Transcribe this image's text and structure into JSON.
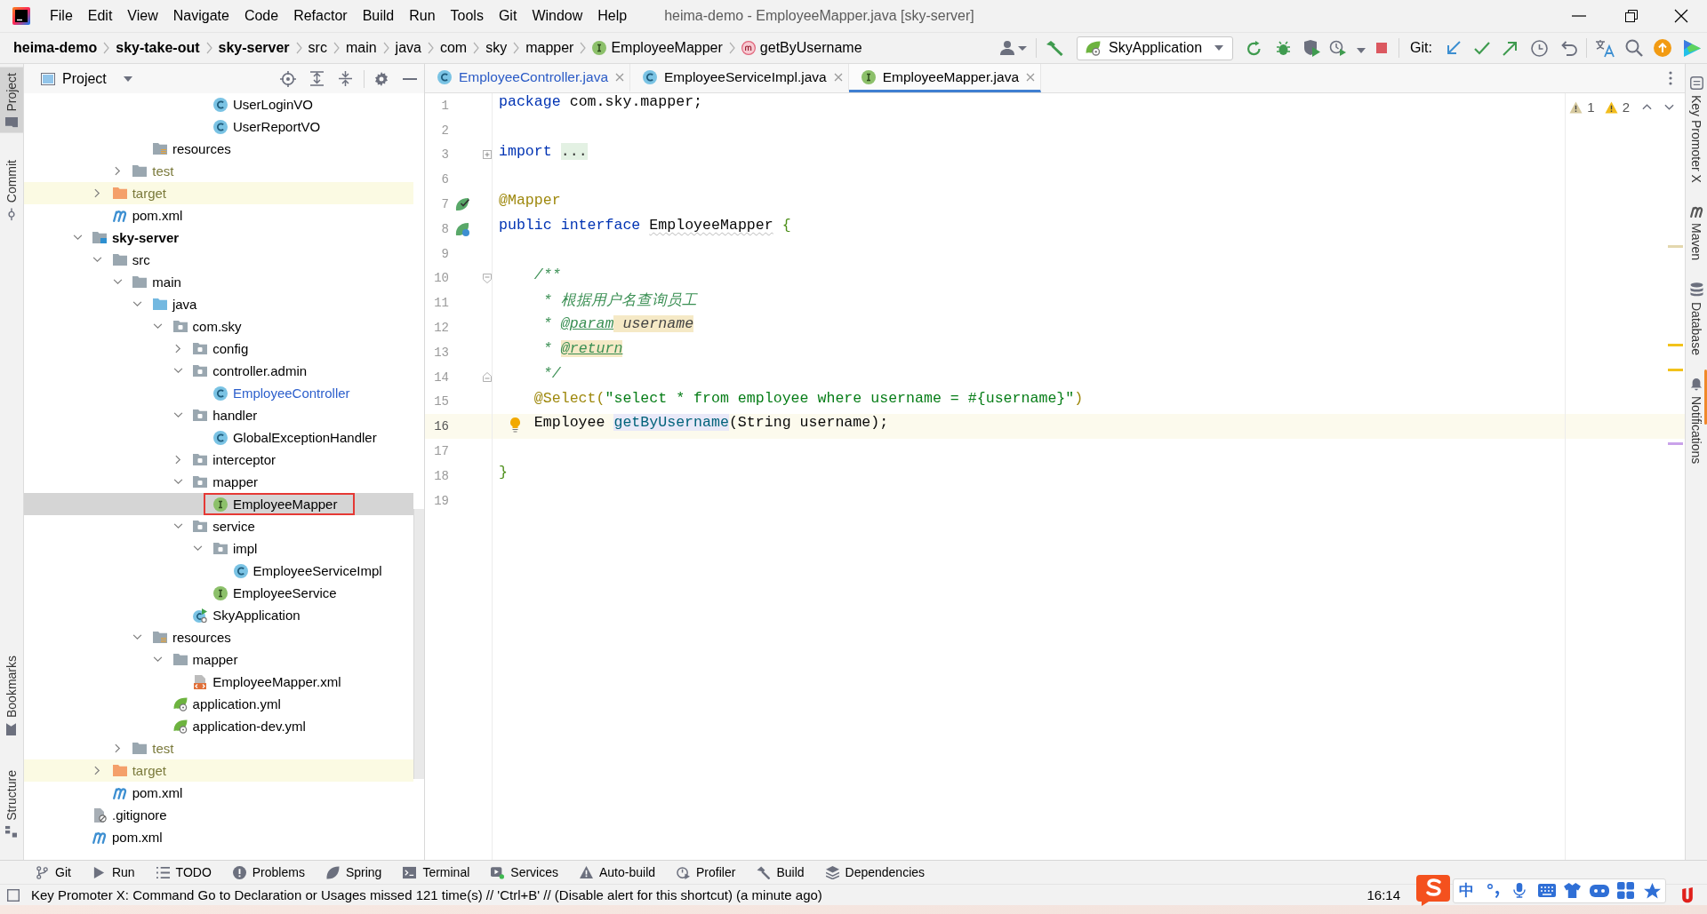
{
  "menubar": {
    "items": [
      "File",
      "Edit",
      "View",
      "Navigate",
      "Code",
      "Refactor",
      "Build",
      "Run",
      "Tools",
      "Git",
      "Window",
      "Help"
    ],
    "title": "heima-demo - EmployeeMapper.java [sky-server]"
  },
  "navbar": {
    "breadcrumbs": [
      {
        "label": "heima-demo",
        "kind": "root"
      },
      {
        "label": "sky-take-out",
        "kind": "root"
      },
      {
        "label": "sky-server",
        "kind": "root"
      },
      {
        "label": "src",
        "kind": "dir"
      },
      {
        "label": "main",
        "kind": "dir"
      },
      {
        "label": "java",
        "kind": "dir"
      },
      {
        "label": "com",
        "kind": "dir"
      },
      {
        "label": "sky",
        "kind": "dir"
      },
      {
        "label": "mapper",
        "kind": "dir"
      },
      {
        "label": "EmployeeMapper",
        "kind": "interface"
      },
      {
        "label": "getByUsername",
        "kind": "method"
      }
    ],
    "run_config": "SkyApplication",
    "git_label": "Git:"
  },
  "left_strip": {
    "top": [
      {
        "label": "Project",
        "kind": "project",
        "selected": true
      },
      {
        "label": "Commit",
        "kind": "commit",
        "selected": false
      }
    ],
    "bottom": [
      {
        "label": "Bookmarks",
        "kind": "bookmarks",
        "selected": false
      },
      {
        "label": "Structure",
        "kind": "structure",
        "selected": false
      }
    ]
  },
  "project_panel": {
    "title": "Project",
    "tree": [
      {
        "children": [
          {
            "children": [
              {
                "children": [
                  {
                    "children": [
                      {
                        "children": [
                          {
                            "children": [
                              {
                                "children": [
                                  {
                                    "label": "UserLoginVO",
                                    "kind": "class",
                                    "selected": false,
                                    "modified": false,
                                    "boxed": false
                                  },
                                  {
                                    "label": "UserReportVO",
                                    "kind": "class",
                                    "selected": false,
                                    "modified": false,
                                    "boxed": false
                                  }
                                ]
                              }
                            ]
                          }
                        ]
                      },
                      {
                        "label": "resources",
                        "kind": "resources",
                        "selected": false,
                        "modified": false,
                        "boxed": false
                      }
                    ]
                  },
                  {
                    "label": "test",
                    "kind": "test",
                    "expanded": false,
                    "selected": false,
                    "modified": false,
                    "boxed": false
                  }
                ]
              },
              {
                "label": "target",
                "kind": "excluded",
                "expanded": false,
                "selected": false,
                "modified": false,
                "boxed": false
              },
              {
                "label": "pom.xml",
                "kind": "maven",
                "selected": false,
                "modified": false,
                "boxed": false
              }
            ]
          },
          {
            "label": "sky-server",
            "kind": "module",
            "expanded": true,
            "selected": false,
            "modified": false,
            "boxed": false,
            "children": [
              {
                "label": "src",
                "kind": "folder",
                "expanded": true,
                "selected": false,
                "modified": false,
                "boxed": false,
                "children": [
                  {
                    "label": "main",
                    "kind": "folder",
                    "expanded": true,
                    "selected": false,
                    "modified": false,
                    "boxed": false,
                    "children": [
                      {
                        "label": "java",
                        "kind": "source",
                        "expanded": true,
                        "selected": false,
                        "modified": false,
                        "boxed": false,
                        "children": [
                          {
                            "label": "com.sky",
                            "kind": "package",
                            "expanded": true,
                            "selected": false,
                            "modified": false,
                            "boxed": false,
                            "children": [
                              {
                                "label": "config",
                                "kind": "package",
                                "expanded": false,
                                "selected": false,
                                "modified": false,
                                "boxed": false
                              },
                              {
                                "label": "controller.admin",
                                "kind": "package",
                                "expanded": true,
                                "selected": false,
                                "modified": false,
                                "boxed": false,
                                "children": [
                                  {
                                    "label": "EmployeeController",
                                    "kind": "class",
                                    "selected": false,
                                    "modified": true,
                                    "boxed": false
                                  }
                                ]
                              },
                              {
                                "label": "handler",
                                "kind": "package",
                                "expanded": true,
                                "selected": false,
                                "modified": false,
                                "boxed": false,
                                "children": [
                                  {
                                    "label": "GlobalExceptionHandler",
                                    "kind": "class",
                                    "selected": false,
                                    "modified": false,
                                    "boxed": false
                                  }
                                ]
                              },
                              {
                                "label": "interceptor",
                                "kind": "package",
                                "expanded": false,
                                "selected": false,
                                "modified": false,
                                "boxed": false
                              },
                              {
                                "label": "mapper",
                                "kind": "package",
                                "expanded": true,
                                "selected": false,
                                "modified": false,
                                "boxed": false,
                                "children": [
                                  {
                                    "label": "EmployeeMapper",
                                    "kind": "interface",
                                    "selected": true,
                                    "modified": false,
                                    "boxed": true
                                  }
                                ]
                              },
                              {
                                "label": "service",
                                "kind": "package",
                                "expanded": true,
                                "selected": false,
                                "modified": false,
                                "boxed": false,
                                "children": [
                                  {
                                    "label": "impl",
                                    "kind": "package",
                                    "expanded": true,
                                    "selected": false,
                                    "modified": false,
                                    "boxed": false,
                                    "children": [
                                      {
                                        "label": "EmployeeServiceImpl",
                                        "kind": "class",
                                        "selected": false,
                                        "modified": false,
                                        "boxed": false
                                      }
                                    ]
                                  },
                                  {
                                    "label": "EmployeeService",
                                    "kind": "interface",
                                    "selected": false,
                                    "modified": false,
                                    "boxed": false
                                  }
                                ]
                              },
                              {
                                "label": "SkyApplication",
                                "kind": "app",
                                "selected": false,
                                "modified": false,
                                "boxed": false
                              }
                            ]
                          }
                        ]
                      },
                      {
                        "label": "resources",
                        "kind": "resources",
                        "expanded": true,
                        "selected": false,
                        "modified": false,
                        "boxed": false,
                        "children": [
                          {
                            "label": "mapper",
                            "kind": "folder",
                            "expanded": true,
                            "selected": false,
                            "modified": false,
                            "boxed": false,
                            "children": [
                              {
                                "label": "EmployeeMapper.xml",
                                "kind": "xml",
                                "selected": false,
                                "modified": false,
                                "boxed": false
                              }
                            ]
                          },
                          {
                            "label": "application.yml",
                            "kind": "config",
                            "selected": false,
                            "modified": false,
                            "boxed": false
                          },
                          {
                            "label": "application-dev.yml",
                            "kind": "config",
                            "selected": false,
                            "modified": false,
                            "boxed": false
                          }
                        ]
                      }
                    ]
                  },
                  {
                    "label": "test",
                    "kind": "test",
                    "expanded": false,
                    "selected": false,
                    "modified": false,
                    "boxed": false
                  }
                ]
              },
              {
                "label": "target",
                "kind": "excluded",
                "expanded": false,
                "selected": false,
                "modified": false,
                "boxed": false
              },
              {
                "label": "pom.xml",
                "kind": "maven",
                "selected": false,
                "modified": false,
                "boxed": false
              }
            ]
          },
          {
            "label": ".gitignore",
            "kind": "ignore",
            "selected": false,
            "modified": false,
            "boxed": false
          },
          {
            "label": "pom.xml",
            "kind": "maven",
            "selected": false,
            "modified": false,
            "boxed": false
          }
        ]
      }
    ]
  },
  "tabs": [
    {
      "label": "EmployeeController.java",
      "kind": "class",
      "modified": true,
      "selected": false
    },
    {
      "label": "EmployeeServiceImpl.java",
      "kind": "class",
      "modified": false,
      "selected": false
    },
    {
      "label": "EmployeeMapper.java",
      "kind": "interface",
      "modified": false,
      "selected": true
    }
  ],
  "editor": {
    "inspections": [
      {
        "kind": "weak",
        "count": "1"
      },
      {
        "kind": "warning",
        "count": "2"
      }
    ],
    "lines": [
      {
        "number": "1",
        "current": false,
        "tokens": [
          {
            "kind": "keyword",
            "text": "package"
          },
          {
            "kind": "plain",
            "text": " com.sky.mapper;"
          }
        ]
      },
      {
        "number": "2",
        "current": false
      },
      {
        "number": "3",
        "current": false,
        "fold_marker": {
          "kind": "collapsed"
        },
        "tokens": [
          {
            "kind": "keyword",
            "text": "import "
          },
          {
            "kind": "folded",
            "text": "..."
          }
        ]
      },
      {
        "number": "6",
        "current": false
      },
      {
        "number": "7",
        "current": false,
        "gutter_icon": {
          "kind": "bean"
        },
        "tokens": [
          {
            "kind": "annotation",
            "text": "@Mapper"
          }
        ]
      },
      {
        "number": "8",
        "current": false,
        "gutter_icon": {
          "kind": "implemented"
        },
        "stripe_mark": {
          "kind": "weak"
        },
        "tokens": [
          {
            "kind": "keyword",
            "text": "public interface "
          },
          {
            "kind": "weak",
            "text": "EmployeeMapper"
          },
          {
            "kind": "brace",
            "text": " {"
          }
        ]
      },
      {
        "number": "9",
        "current": false
      },
      {
        "number": "10",
        "current": false,
        "fold_marker": {
          "kind": "start"
        },
        "tokens": [
          {
            "kind": "doc",
            "text": "    /**"
          }
        ]
      },
      {
        "number": "11",
        "current": false,
        "tokens": [
          {
            "kind": "doc",
            "text": "     * 根据用户名查询员工"
          }
        ]
      },
      {
        "number": "12",
        "current": false,
        "stripe_mark": {
          "kind": "warning"
        },
        "tokens": [
          {
            "kind": "doc",
            "text": "     * "
          },
          {
            "kind": "doc_tag",
            "text": "@param"
          },
          {
            "kind": "doc_ref",
            "text": " username"
          }
        ]
      },
      {
        "number": "13",
        "current": false,
        "stripe_mark": {
          "kind": "warning"
        },
        "tokens": [
          {
            "kind": "doc",
            "text": "     * "
          },
          {
            "kind": "doc_tag_marked",
            "text": "@return"
          }
        ]
      },
      {
        "number": "14",
        "current": false,
        "fold_marker": {
          "kind": "end"
        },
        "tokens": [
          {
            "kind": "doc",
            "text": "     */"
          }
        ]
      },
      {
        "number": "15",
        "current": false,
        "tokens": [
          {
            "kind": "annotation",
            "text": "    @Select("
          },
          {
            "kind": "string",
            "text": "\"select * from employee where username = #{username}\""
          },
          {
            "kind": "annotation",
            "text": ")"
          }
        ]
      },
      {
        "number": "16",
        "current": true,
        "hint_icon": {
          "kind": "intention"
        },
        "stripe_mark": {
          "kind": "usage"
        },
        "tokens": [
          {
            "kind": "plain",
            "text": "    Employee "
          },
          {
            "kind": "method",
            "text": "getByUsername"
          },
          {
            "kind": "plain",
            "text": "(String username);"
          }
        ]
      },
      {
        "number": "17",
        "current": false
      },
      {
        "number": "18",
        "current": false,
        "tokens": [
          {
            "kind": "brace",
            "text": "}"
          }
        ]
      },
      {
        "number": "19",
        "current": false
      }
    ]
  },
  "right_strip": [
    {
      "label": "Key Promoter X",
      "kind": "key-promoter"
    },
    {
      "label": "Maven",
      "kind": "maven"
    },
    {
      "label": "Database",
      "kind": "database"
    },
    {
      "label": "Notifications",
      "kind": "notifications"
    }
  ],
  "bottom_bar": [
    {
      "label": "Git",
      "kind": "git"
    },
    {
      "label": "Run",
      "kind": "run"
    },
    {
      "label": "TODO",
      "kind": "todo"
    },
    {
      "label": "Problems",
      "kind": "problems"
    },
    {
      "label": "Spring",
      "kind": "spring"
    },
    {
      "label": "Terminal",
      "kind": "terminal"
    },
    {
      "label": "Services",
      "kind": "services"
    },
    {
      "label": "Auto-build",
      "kind": "auto-build"
    },
    {
      "label": "Profiler",
      "kind": "profiler"
    },
    {
      "label": "Build",
      "kind": "build"
    },
    {
      "label": "Dependencies",
      "kind": "dependencies"
    }
  ],
  "status_bar": {
    "message": "Key Promoter X: Command Go to Declaration or Usages missed 121 time(s) // 'Ctrl+B' // (Disable alert for this shortcut) (a minute ago)",
    "caret_position": "16:14"
  },
  "ime_bar": {
    "mode": "中"
  }
}
